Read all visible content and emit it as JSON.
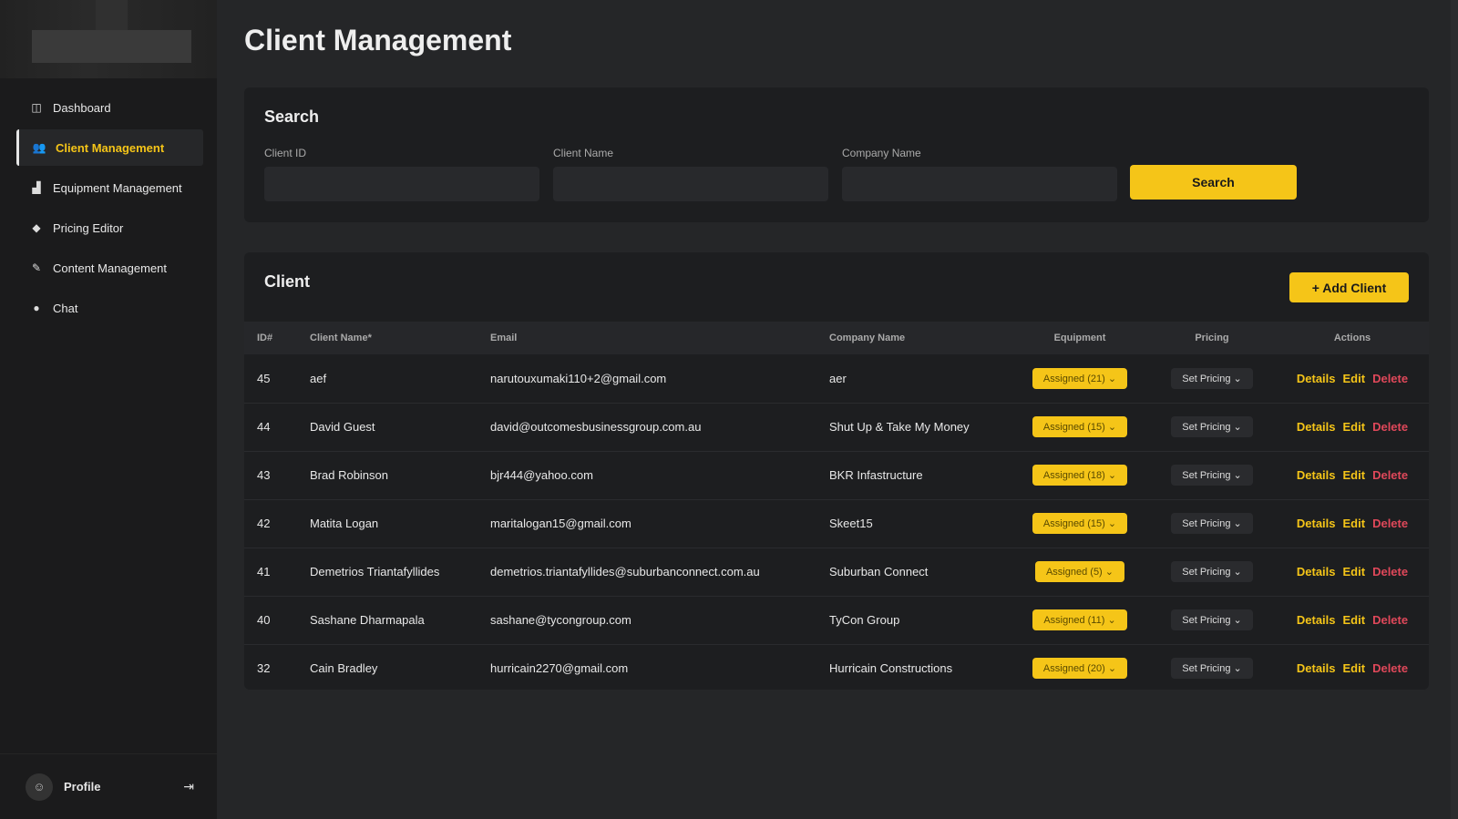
{
  "sidebar": {
    "items": [
      {
        "label": "Dashboard",
        "icon": "dashboard-icon",
        "glyph": "◫"
      },
      {
        "label": "Client Management",
        "icon": "users-icon",
        "glyph": "👥"
      },
      {
        "label": "Equipment Management",
        "icon": "equipment-icon",
        "glyph": "▟"
      },
      {
        "label": "Pricing Editor",
        "icon": "tag-icon",
        "glyph": "◆"
      },
      {
        "label": "Content Management",
        "icon": "pencil-icon",
        "glyph": "✎"
      },
      {
        "label": "Chat",
        "icon": "chat-icon",
        "glyph": "●"
      }
    ],
    "profile": {
      "label": "Profile",
      "avatar_glyph": "☺",
      "logout_glyph": "⇥"
    }
  },
  "page": {
    "title": "Client Management"
  },
  "search": {
    "title": "Search",
    "client_id_label": "Client ID",
    "client_name_label": "Client Name",
    "company_name_label": "Company Name",
    "button": "Search"
  },
  "clients": {
    "title": "Client",
    "add_button": "+ Add Client",
    "columns": [
      "ID#",
      "Client Name*",
      "Email",
      "Company Name",
      "Equipment",
      "Pricing",
      "Actions"
    ],
    "actions": {
      "details": "Details",
      "edit": "Edit",
      "delete": "Delete"
    },
    "rows": [
      {
        "id": "45",
        "name": "aef",
        "email": "narutouxumaki110+2@gmail.com",
        "company": "aer",
        "equipment": "Assigned (21)",
        "pricing": "Set Pricing"
      },
      {
        "id": "44",
        "name": "David Guest",
        "email": "david@outcomesbusinessgroup.com.au",
        "company": "Shut Up & Take My Money",
        "equipment": "Assigned (15)",
        "pricing": "Set Pricing"
      },
      {
        "id": "43",
        "name": "Brad Robinson",
        "email": "bjr444@yahoo.com",
        "company": "BKR Infastructure",
        "equipment": "Assigned (18)",
        "pricing": "Set Pricing"
      },
      {
        "id": "42",
        "name": "Matita Logan",
        "email": "maritalogan15@gmail.com",
        "company": "Skeet15",
        "equipment": "Assigned (15)",
        "pricing": "Set Pricing"
      },
      {
        "id": "41",
        "name": "Demetrios Triantafyllides",
        "email": "demetrios.triantafyllides@suburbanconnect.com.au",
        "company": "Suburban Connect",
        "equipment": "Assigned (5)",
        "pricing": "Set Pricing"
      },
      {
        "id": "40",
        "name": "Sashane Dharmapala",
        "email": "sashane@tycongroup.com",
        "company": "TyCon Group",
        "equipment": "Assigned (11)",
        "pricing": "Set Pricing"
      },
      {
        "id": "32",
        "name": "Cain Bradley",
        "email": "hurricain2270@gmail.com",
        "company": "Hurricain Constructions",
        "equipment": "Assigned (20)",
        "pricing": "Set Pricing"
      }
    ]
  }
}
